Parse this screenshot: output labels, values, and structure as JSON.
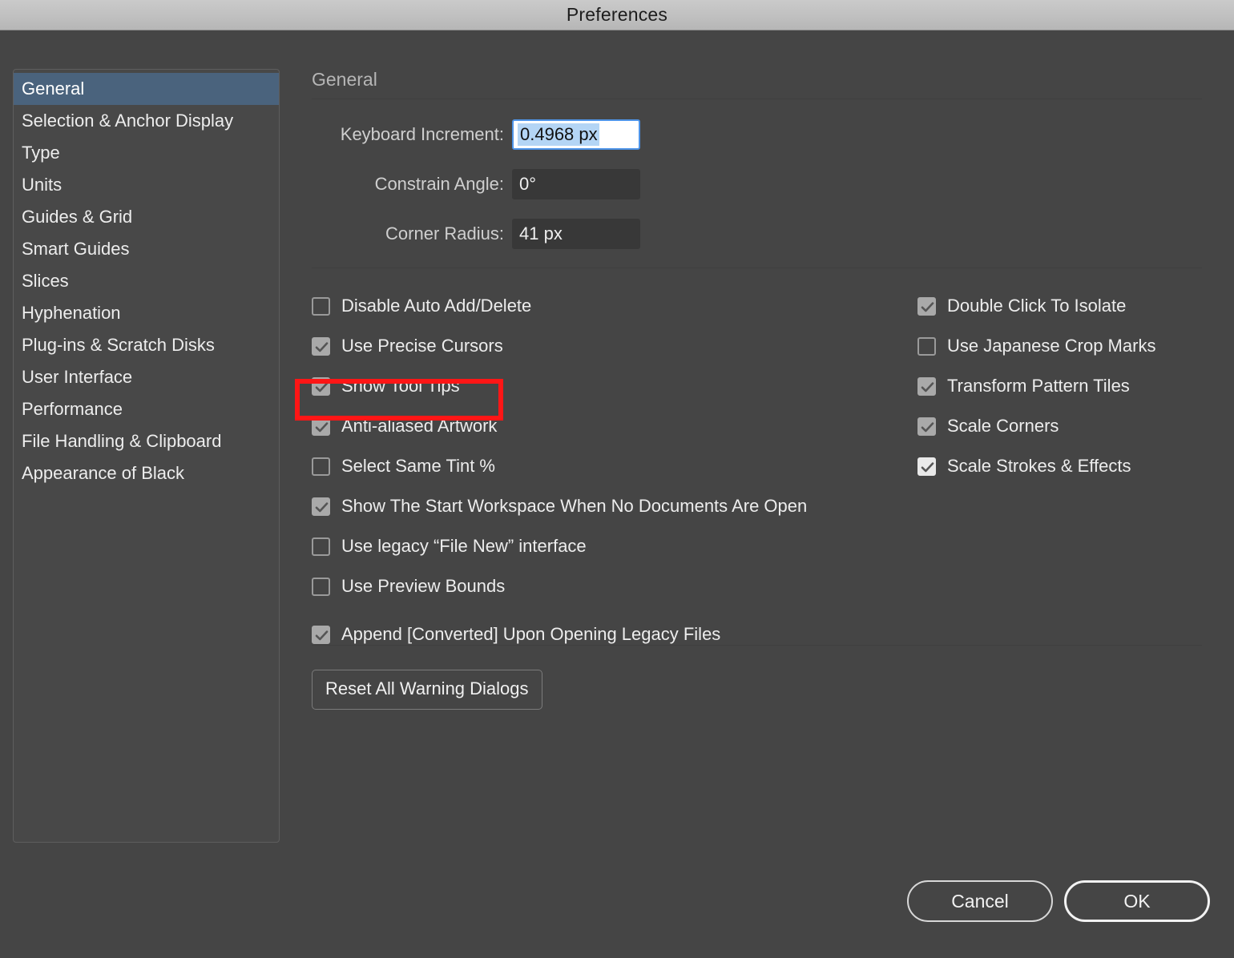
{
  "window": {
    "title": "Preferences"
  },
  "sidebar": {
    "items": [
      {
        "label": "General",
        "selected": true
      },
      {
        "label": "Selection & Anchor Display",
        "selected": false
      },
      {
        "label": "Type",
        "selected": false
      },
      {
        "label": "Units",
        "selected": false
      },
      {
        "label": "Guides & Grid",
        "selected": false
      },
      {
        "label": "Smart Guides",
        "selected": false
      },
      {
        "label": "Slices",
        "selected": false
      },
      {
        "label": "Hyphenation",
        "selected": false
      },
      {
        "label": "Plug-ins & Scratch Disks",
        "selected": false
      },
      {
        "label": "User Interface",
        "selected": false
      },
      {
        "label": "Performance",
        "selected": false
      },
      {
        "label": "File Handling & Clipboard",
        "selected": false
      },
      {
        "label": "Appearance of Black",
        "selected": false
      }
    ]
  },
  "main": {
    "section_title": "General",
    "fields": [
      {
        "label": "Keyboard Increment:",
        "value": "0.4968 px",
        "focused": true,
        "selected_text": true
      },
      {
        "label": "Constrain Angle:",
        "value": "0°",
        "focused": false,
        "selected_text": false
      },
      {
        "label": "Corner Radius:",
        "value": "41 px",
        "focused": false,
        "selected_text": false
      }
    ],
    "checkboxes_left": [
      {
        "label": "Disable Auto Add/Delete",
        "checked": false,
        "bright": false,
        "gap": false
      },
      {
        "label": "Use Precise Cursors",
        "checked": true,
        "bright": false,
        "gap": false
      },
      {
        "label": "Show Tool Tips",
        "checked": true,
        "bright": false,
        "gap": false,
        "highlighted": true
      },
      {
        "label": "Anti-aliased Artwork",
        "checked": true,
        "bright": false,
        "gap": false
      },
      {
        "label": "Select Same Tint %",
        "checked": false,
        "bright": false,
        "gap": false
      },
      {
        "label": "Show The Start Workspace When No Documents Are Open",
        "checked": true,
        "bright": false,
        "gap": false
      },
      {
        "label": "Use legacy “File New” interface",
        "checked": false,
        "bright": false,
        "gap": false
      },
      {
        "label": "Use Preview Bounds",
        "checked": false,
        "bright": false,
        "gap": false
      },
      {
        "label": "Append [Converted] Upon Opening Legacy Files",
        "checked": true,
        "bright": false,
        "gap": true
      }
    ],
    "checkboxes_right": [
      {
        "label": "Double Click To Isolate",
        "checked": true,
        "bright": false
      },
      {
        "label": "Use Japanese Crop Marks",
        "checked": false,
        "bright": false
      },
      {
        "label": "Transform Pattern Tiles",
        "checked": true,
        "bright": false
      },
      {
        "label": "Scale Corners",
        "checked": true,
        "bright": false
      },
      {
        "label": "Scale Strokes & Effects",
        "checked": true,
        "bright": true
      }
    ],
    "reset_button": "Reset All Warning Dialogs"
  },
  "footer": {
    "cancel": "Cancel",
    "ok": "OK"
  },
  "annotation": {
    "target": "Show Tool Tips",
    "color": "#fe1616"
  },
  "colors": {
    "dialog_bg": "#454545",
    "titlebar_bg": "#c0c0c0",
    "selection_blue": "#4a637d",
    "focus_border": "#4e94e8",
    "text_selection": "#b4d5f5",
    "annotation_red": "#fe1616"
  }
}
